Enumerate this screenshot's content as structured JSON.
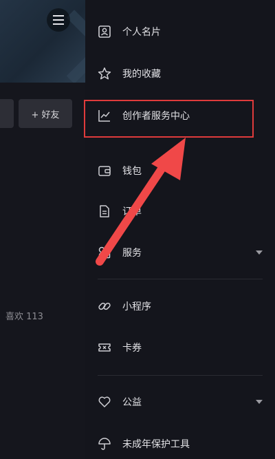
{
  "profile": {
    "add_friend_label": "+ 好友",
    "likes_text": "喜欢 113"
  },
  "drawer": {
    "items": [
      {
        "label": "个人名片",
        "icon": "id-card-icon"
      },
      {
        "label": "我的收藏",
        "icon": "star-icon"
      },
      {
        "label": "创作者服务中心",
        "icon": "trend-chart-icon"
      },
      {
        "label": "钱包",
        "icon": "wallet-icon"
      },
      {
        "label": "订单",
        "icon": "document-icon"
      },
      {
        "label": "服务",
        "icon": "services-icon",
        "expandable": true
      },
      {
        "label": "小程序",
        "icon": "link-icon"
      },
      {
        "label": "卡券",
        "icon": "ticket-icon"
      },
      {
        "label": "公益",
        "icon": "heart-icon",
        "expandable": true
      },
      {
        "label": "未成年保护工具",
        "icon": "umbrella-icon"
      }
    ]
  },
  "annotation": {
    "highlight_color": "#e03b3b",
    "arrow_color": "#f04848"
  }
}
